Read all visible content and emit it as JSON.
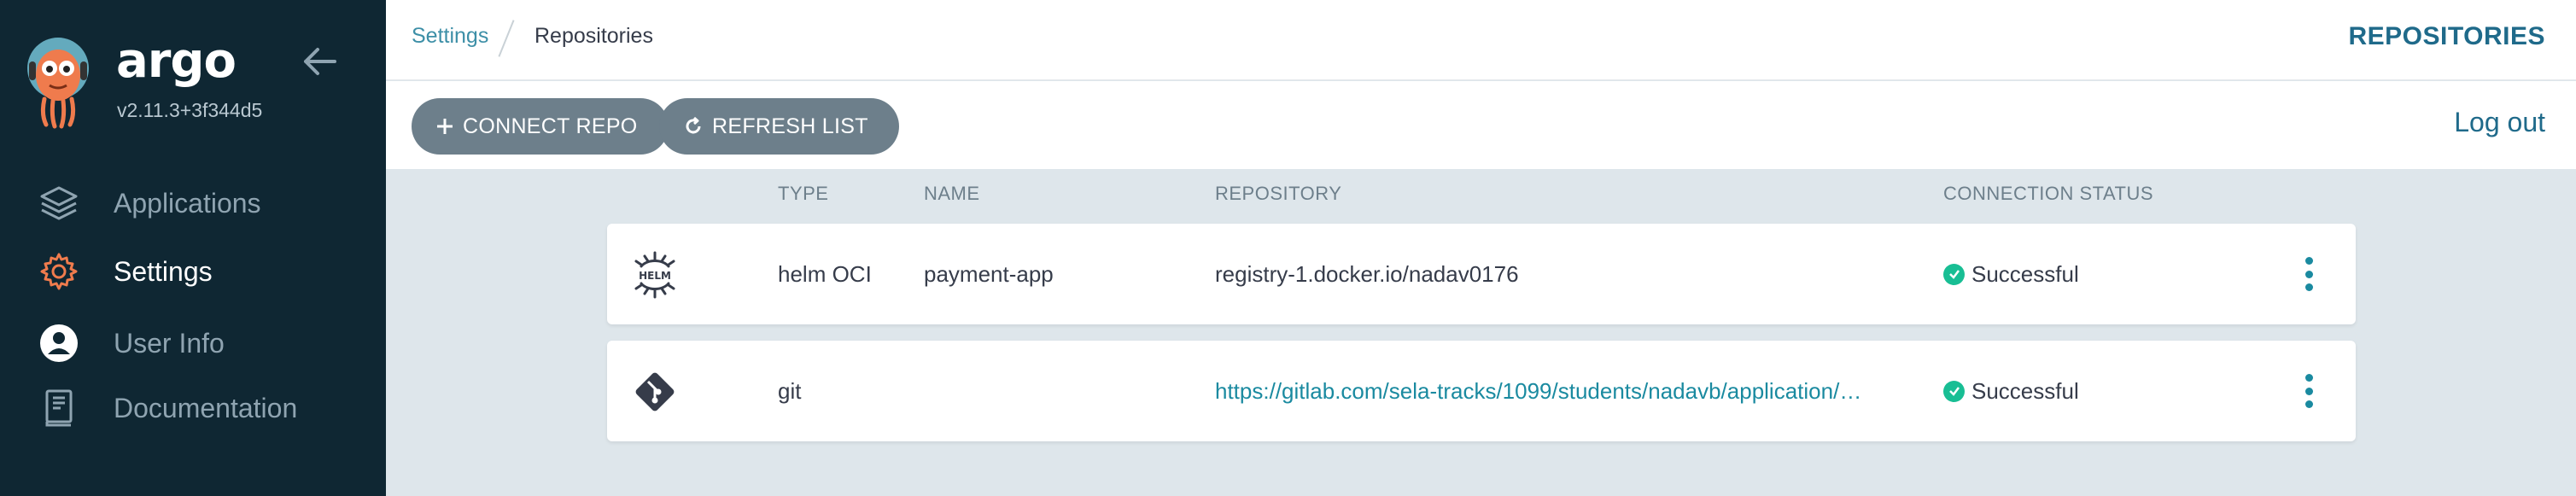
{
  "sidebar": {
    "brand": "argo",
    "version": "v2.11.3+3f344d5",
    "items": [
      {
        "label": "Applications",
        "icon": "layers-icon"
      },
      {
        "label": "Settings",
        "icon": "gear-icon",
        "active": true
      },
      {
        "label": "User Info",
        "icon": "user-circle-icon"
      },
      {
        "label": "Documentation",
        "icon": "book-icon"
      }
    ]
  },
  "breadcrumb": {
    "parent": "Settings",
    "current": "Repositories"
  },
  "header": {
    "title": "REPOSITORIES"
  },
  "toolbar": {
    "connect_label": "CONNECT REPO",
    "refresh_label": "REFRESH LIST",
    "logout_label": "Log out"
  },
  "table": {
    "columns": [
      "TYPE",
      "NAME",
      "REPOSITORY",
      "CONNECTION STATUS"
    ],
    "rows": [
      {
        "icon": "helm-icon",
        "type": "helm OCI",
        "name": "payment-app",
        "repository": "registry-1.docker.io/nadav0176",
        "status": "Successful"
      },
      {
        "icon": "git-icon",
        "type": "git",
        "name": "",
        "repository": "https://gitlab.com/sela-tracks/1099/students/nadavb/application/…",
        "status": "Successful"
      }
    ]
  },
  "colors": {
    "sidebar_bg": "#0f2733",
    "accent": "#1a8aa0",
    "button": "#6d7f8b",
    "success": "#18be94",
    "page_bg": "#dee6eb"
  }
}
